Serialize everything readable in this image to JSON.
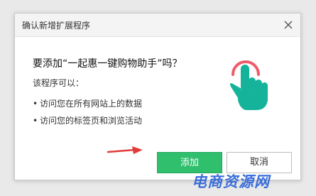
{
  "dialog": {
    "title": "确认新增扩展程序",
    "question": "要添加“一起惠一键购物助手”吗？",
    "intro": "该程序可以：",
    "permissions": [
      "访问您在所有网站上的数据",
      "访问您的标签页和浏览活动"
    ],
    "add_label": "添加",
    "cancel_label": "取消",
    "extension_icon": "hand-tap-icon"
  },
  "watermark": {
    "text": "电商资源网"
  },
  "colors": {
    "accent_green": "#2fbf6d",
    "icon_teal": "#14b39a",
    "tap_ring_red": "#ef5b6b",
    "arrow_red": "#e23a3a",
    "watermark_blue": "#2c63d8"
  }
}
